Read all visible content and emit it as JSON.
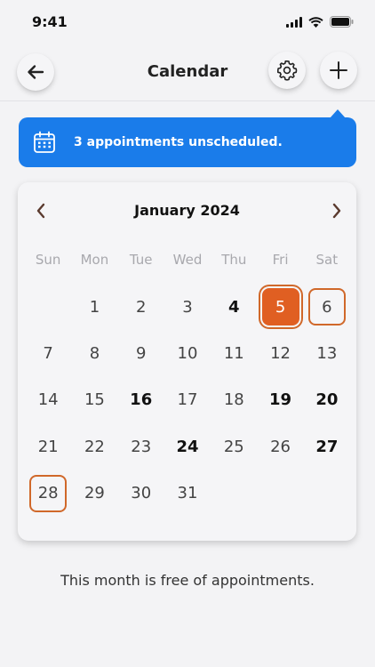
{
  "status_bar": {
    "time": "9:41"
  },
  "header": {
    "title": "Calendar"
  },
  "banner": {
    "message": "3 appointments unscheduled."
  },
  "calendar": {
    "month_label": "January 2024",
    "weekdays": [
      "Sun",
      "Mon",
      "Tue",
      "Wed",
      "Thu",
      "Fri",
      "Sat"
    ],
    "leading_blanks": 1,
    "days": [
      {
        "n": "1",
        "style": ""
      },
      {
        "n": "2",
        "style": ""
      },
      {
        "n": "3",
        "style": ""
      },
      {
        "n": "4",
        "style": "bold"
      },
      {
        "n": "5",
        "style": "selected"
      },
      {
        "n": "6",
        "style": "outline"
      },
      {
        "n": "7",
        "style": ""
      },
      {
        "n": "8",
        "style": ""
      },
      {
        "n": "9",
        "style": ""
      },
      {
        "n": "10",
        "style": ""
      },
      {
        "n": "11",
        "style": ""
      },
      {
        "n": "12",
        "style": ""
      },
      {
        "n": "13",
        "style": ""
      },
      {
        "n": "14",
        "style": ""
      },
      {
        "n": "15",
        "style": ""
      },
      {
        "n": "16",
        "style": "bold"
      },
      {
        "n": "17",
        "style": ""
      },
      {
        "n": "18",
        "style": ""
      },
      {
        "n": "19",
        "style": "bold"
      },
      {
        "n": "20",
        "style": "bold"
      },
      {
        "n": "21",
        "style": ""
      },
      {
        "n": "22",
        "style": ""
      },
      {
        "n": "23",
        "style": ""
      },
      {
        "n": "24",
        "style": "bold"
      },
      {
        "n": "25",
        "style": ""
      },
      {
        "n": "26",
        "style": ""
      },
      {
        "n": "27",
        "style": "bold"
      },
      {
        "n": "28",
        "style": "outline"
      },
      {
        "n": "29",
        "style": ""
      },
      {
        "n": "30",
        "style": ""
      },
      {
        "n": "31",
        "style": ""
      }
    ]
  },
  "footer": {
    "message": "This month is free of appointments."
  },
  "icons": {
    "back": "arrow-left-icon",
    "settings": "gear-icon",
    "add": "plus-icon",
    "banner": "calendar-icon",
    "prev": "chevron-left-icon",
    "next": "chevron-right-icon"
  },
  "colors": {
    "accent": "#1a7cea",
    "selected": "#e05f22",
    "outline": "#d0682a"
  }
}
